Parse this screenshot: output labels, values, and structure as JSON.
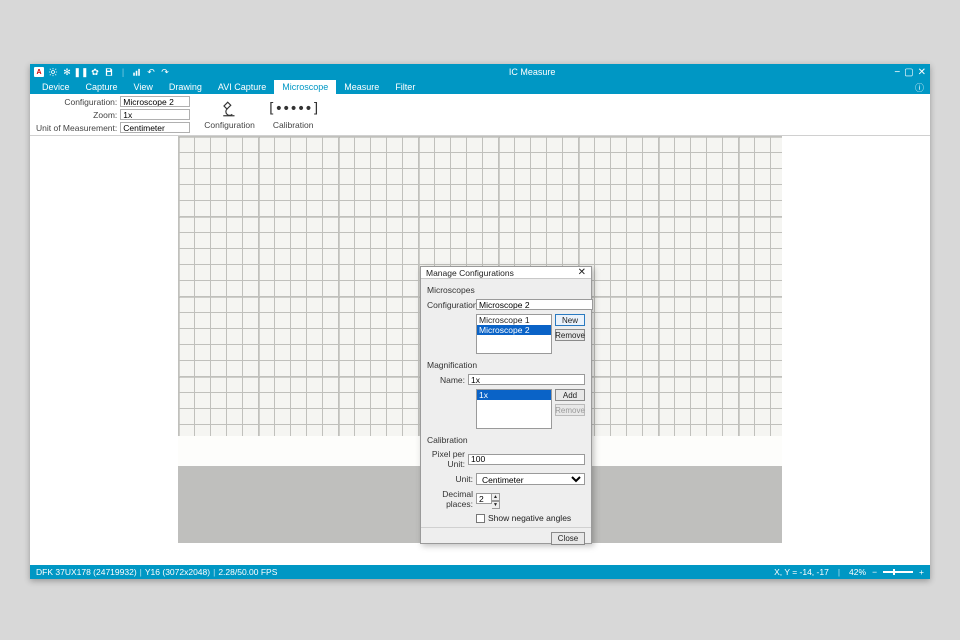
{
  "titlebar": {
    "app_title": "IC Measure",
    "min": "−",
    "restore": "▢",
    "close": "✕"
  },
  "tabs": {
    "items": [
      "Device",
      "Capture",
      "View",
      "Drawing",
      "AVI Capture",
      "Microscope",
      "Measure",
      "Filter"
    ],
    "active_index": 5,
    "help": "ⓘ"
  },
  "ribbon": {
    "configuration_label": "Configuration:",
    "configuration_value": "Microscope 2",
    "zoom_label": "Zoom:",
    "zoom_value": "1x",
    "unit_label": "Unit of Measurement:",
    "unit_value": "Centimeter",
    "btn_configuration": "Configuration",
    "btn_calibration": "Calibration"
  },
  "dialog": {
    "title": "Manage Configurations",
    "sec_microscopes": "Microscopes",
    "config_label": "Configuration:",
    "config_value": "Microscope 2",
    "config_list": [
      "Microscope 1",
      "Microscope 2"
    ],
    "config_selected_index": 1,
    "btn_new": "New",
    "btn_remove": "Remove",
    "sec_magnification": "Magnification",
    "mag_name_label": "Name:",
    "mag_name_value": "1x",
    "mag_list": [
      "1x"
    ],
    "mag_selected_index": 0,
    "btn_add": "Add",
    "btn_remove2": "Remove",
    "sec_calibration": "Calibration",
    "ppu_label": "Pixel per Unit:",
    "ppu_value": "100",
    "unit_label": "Unit:",
    "unit_value": "Centimeter",
    "decimals_label": "Decimal places:",
    "decimals_value": "2",
    "show_neg_label": "Show negative angles",
    "btn_close": "Close"
  },
  "status": {
    "camera": "DFK 37UX178 (24719932)",
    "format": "Y16 (3072x2048)",
    "fps": "2.28/50.00 FPS",
    "coords": "X, Y = -14, -17",
    "zoom_pct": "42%",
    "minus": "−",
    "plus": "+"
  }
}
